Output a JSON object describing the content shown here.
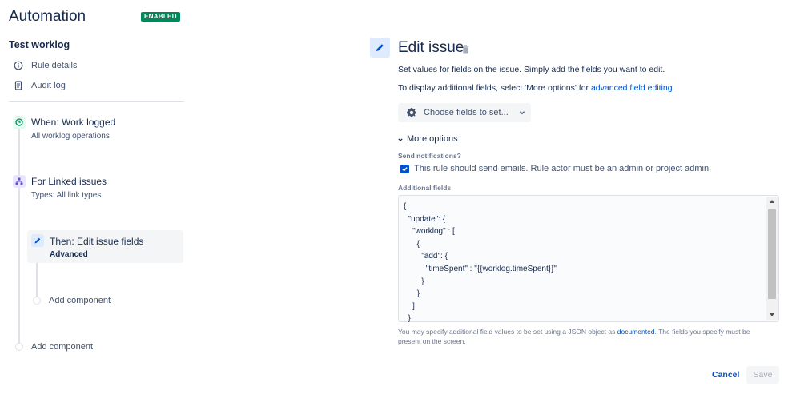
{
  "app": {
    "title": "Automation",
    "status": "ENABLED",
    "status_color": "#00875a"
  },
  "sidebar": {
    "rule_name": "Test worklog",
    "nav": [
      {
        "label": "Rule details",
        "icon": "info-icon"
      },
      {
        "label": "Audit log",
        "icon": "document-icon"
      }
    ],
    "components": {
      "trigger": {
        "title": "When: Work logged",
        "subtitle": "All worklog operations",
        "icon": "clock-icon"
      },
      "branch": {
        "title": "For Linked issues",
        "subtitle": "Types: All link types",
        "icon": "hierarchy-icon"
      },
      "action": {
        "title": "Then: Edit issue fields",
        "subtitle": "Advanced",
        "icon": "pencil-icon"
      },
      "add_inner": "Add component",
      "add_outer": "Add component"
    }
  },
  "panel": {
    "title": "Edit issue",
    "icon": "pencil-icon",
    "description": "Set values for fields on the issue. Simply add the fields you want to edit.",
    "more_fields_text": "To display additional fields, select 'More options' for ",
    "more_fields_link": "advanced field editing",
    "more_fields_end": ".",
    "choose_fields": {
      "label": "Choose fields to set...",
      "icon": "gear-icon"
    },
    "more_options": "More options",
    "send_notifications": {
      "label": "Send notifications?",
      "checkbox_label": "This rule should send emails. Rule actor must be an admin or project admin.",
      "checked": true
    },
    "additional_fields": {
      "label": "Additional fields",
      "value": "{\n  \"update\": {\n    \"worklog\" : [\n      {\n        \"add\": {\n          \"timeSpent\" : \"{{worklog.timeSpent}}\"\n        }\n      }\n    ]\n  }"
    },
    "help_text_start": "You may specify additional field values to be set using a JSON object as ",
    "help_link": "documented",
    "help_text_end": ". The fields you specify must be present on the screen.",
    "cancel_label": "Cancel",
    "save_label": "Save"
  },
  "colors": {
    "primary": "#0052cc",
    "text": "#172b4d",
    "subtle": "#42526e"
  }
}
